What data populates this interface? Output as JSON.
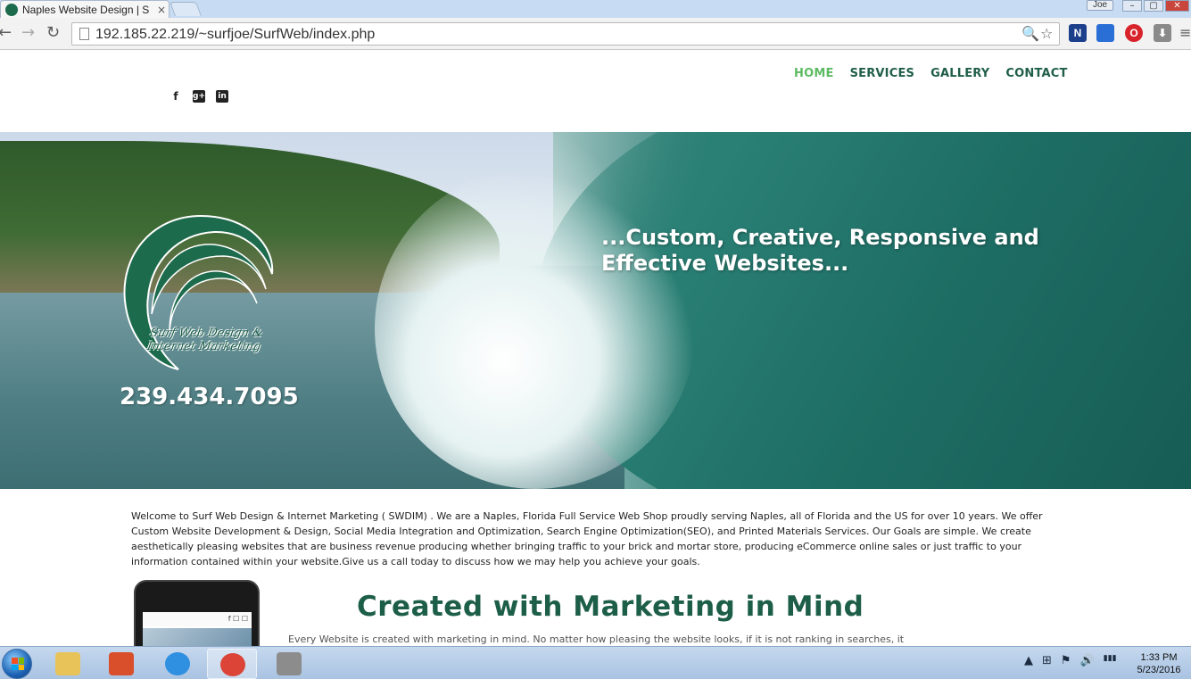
{
  "browser": {
    "tab_title": "Naples Website Design | S",
    "tab_close": "×",
    "user_badge": "Joe",
    "window_controls": [
      "–",
      "▢",
      "✕"
    ],
    "url": "192.185.22.219/~surfjoe/SurfWeb/index.php",
    "icons": [
      "back-icon",
      "forward-icon",
      "reload-icon",
      "zoom-icon",
      "bookmark-star-icon"
    ],
    "extensions": [
      {
        "name": "n-extension-icon",
        "glyph": "N",
        "color": "#1b3f8a"
      },
      {
        "name": "blue-extension-icon",
        "glyph": "",
        "color": "#2a6fd6"
      },
      {
        "name": "opera-icon",
        "glyph": "O",
        "color": "#d8232a"
      },
      {
        "name": "download-icon",
        "glyph": "⬇",
        "color": "#8a8a8a"
      }
    ]
  },
  "site": {
    "nav": [
      {
        "label": "HOME",
        "active": true
      },
      {
        "label": "SERVICES",
        "active": false
      },
      {
        "label": "GALLERY",
        "active": false
      },
      {
        "label": "CONTACT",
        "active": false
      }
    ],
    "social": [
      "f",
      "g+",
      "in"
    ],
    "logo_text": [
      "Surf Web Design &",
      "Internet Marketing"
    ],
    "phone": "239.434.7095",
    "tagline": "...Custom, Creative, Responsive and Effective Websites...",
    "intro": "Welcome to Surf Web Design & Internet Marketing ( SWDIM) . We are a Naples, Florida Full Service Web Shop proudly serving Naples, all of Florida and the US for over 10 years. We offer Custom Website Development & Design, Social Media Integration and Optimization, Search Engine Optimization(SEO), and Printed Materials Services. Our Goals are simple. We create aesthetically pleasing websites that are business revenue producing whether bringing traffic to your brick and mortar store, producing eCommerce online sales or just traffic to your information contained within your website.Give us a call today to discuss how we may help you achieve your goals.",
    "section_title": "Created with Marketing in Mind",
    "section_copy": "Every Website is created with marketing in mind. No matter how pleasing the website looks, if it is not ranking in searches, it",
    "device_bar": "f ☐ ☐",
    "colors": {
      "nav_text": "#1f5e49",
      "nav_active": "#5dbb63",
      "brand_green": "#1d5e48"
    }
  },
  "taskbar": {
    "apps": [
      {
        "name": "explorer-icon",
        "color": "#e8c35a",
        "active": false
      },
      {
        "name": "app-icon",
        "color": "#d94f2b",
        "active": false
      },
      {
        "name": "ie-icon",
        "color": "#2f8fe0",
        "active": false
      },
      {
        "name": "chrome-icon",
        "color": "#db4437",
        "active": true
      },
      {
        "name": "camera-icon",
        "color": "#8c8c8c",
        "active": false
      }
    ],
    "tray": [
      "▲",
      "⊞",
      "⚑",
      "🔊",
      "▮▮▮"
    ],
    "time": "1:33 PM",
    "date": "5/23/2016"
  }
}
